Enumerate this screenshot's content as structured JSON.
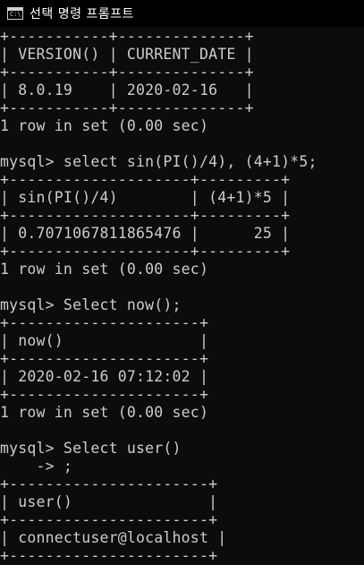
{
  "window": {
    "title": "선택 명령 프롬프트",
    "icon_text": "C:\\",
    "icon": "console-window-icon"
  },
  "colors": {
    "background": "#0c0c0c",
    "titlebar": "#000000",
    "text": "#cccccc",
    "title_text": "#ffffff"
  },
  "console": {
    "lines": [
      "+-----------+--------------+",
      "| VERSION() | CURRENT_DATE |",
      "+-----------+--------------+",
      "| 8.0.19    | 2020-02-16   |",
      "+-----------+--------------+",
      "1 row in set (0.00 sec)",
      "",
      "mysql> select sin(PI()/4), (4+1)*5;",
      "+--------------------+---------+",
      "| sin(PI()/4)        | (4+1)*5 |",
      "+--------------------+---------+",
      "| 0.7071067811865476 |      25 |",
      "+--------------------+---------+",
      "1 row in set (0.00 sec)",
      "",
      "mysql> Select now();",
      "+---------------------+",
      "| now()               |",
      "+---------------------+",
      "| 2020-02-16 07:12:02 |",
      "+---------------------+",
      "1 row in set (0.00 sec)",
      "",
      "mysql> Select user()",
      "    -> ;",
      "+----------------------+",
      "| user()               |",
      "+----------------------+",
      "| connectuser@localhost |",
      "+----------------------+"
    ]
  }
}
